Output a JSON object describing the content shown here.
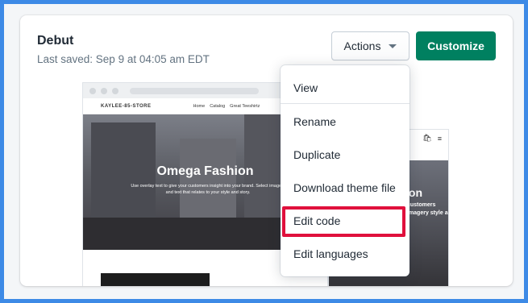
{
  "theme": {
    "name": "Debut",
    "last_saved": "Last saved: Sep 9 at 04:05 am EDT"
  },
  "buttons": {
    "actions_label": "Actions",
    "customize_label": "Customize"
  },
  "preview": {
    "store_name": "KAYLEE-85-STORE",
    "nav_links": [
      "Home",
      "Catalog",
      "Great Teeshirtz"
    ],
    "hero_title": "Omega Fashion",
    "hero_text": "Use overlay text to give your customers insight into your brand. Select imagery and text that relates to your style and story.",
    "mobile_title": "ion",
    "mobile_text": "customers imagery style and"
  },
  "actions_menu": {
    "items": [
      {
        "label": "View"
      },
      {
        "label": "Rename"
      },
      {
        "label": "Duplicate"
      },
      {
        "label": "Download theme file"
      },
      {
        "label": "Edit code"
      },
      {
        "label": "Edit languages"
      }
    ]
  },
  "colors": {
    "primary": "#008060",
    "highlight": "#e0103c",
    "background": "#3d8ae6"
  }
}
